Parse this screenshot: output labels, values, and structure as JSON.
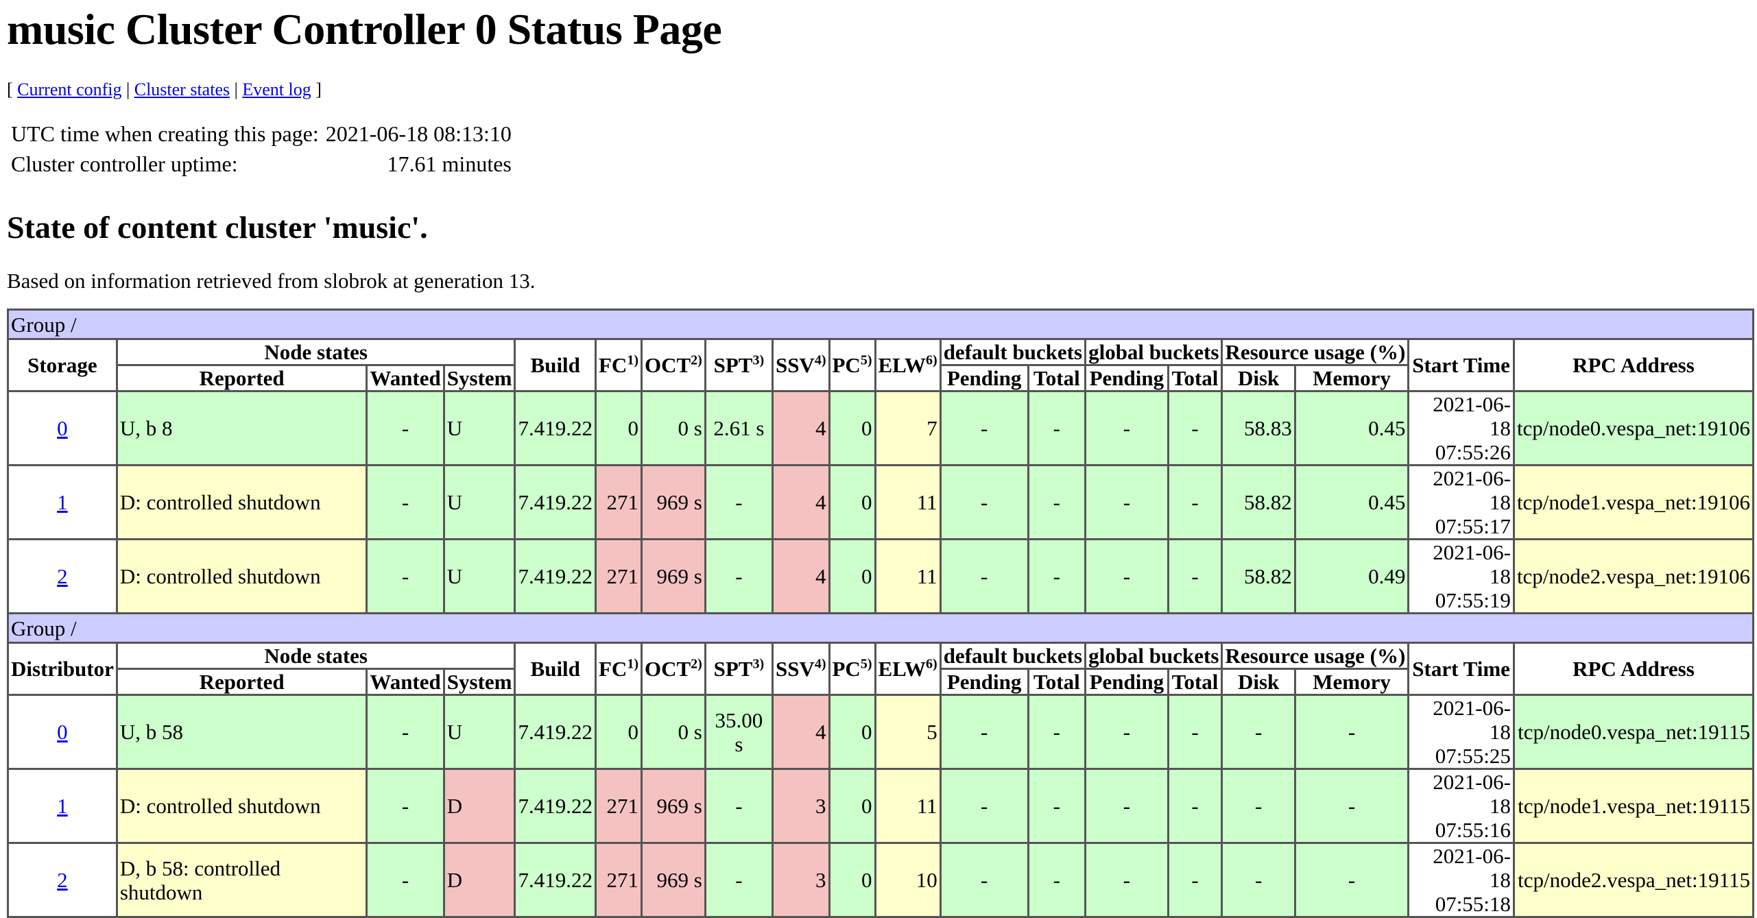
{
  "title": "music Cluster Controller 0 Status Page",
  "nav": {
    "open": "[",
    "close": "]",
    "sep": "|",
    "links": [
      "Current config",
      "Cluster states",
      "Event log"
    ]
  },
  "meta": {
    "utc_label": "UTC time when creating this page:",
    "utc_value": "2021-06-18 08:13:10",
    "uptime_label": "Cluster controller uptime:",
    "uptime_value": "17.61 minutes"
  },
  "cluster_title": "State of content cluster 'music'.",
  "based_on": "Based on information retrieved from slobrok at generation 13.",
  "headers": {
    "node_states": "Node states",
    "reported": "Reported",
    "wanted": "Wanted",
    "system": "System",
    "build": "Build",
    "fc": "FC",
    "fc_sup": "1)",
    "oct": "OCT",
    "oct_sup": "2)",
    "spt": "SPT",
    "spt_sup": "3)",
    "ssv": "SSV",
    "ssv_sup": "4)",
    "pc": "PC",
    "pc_sup": "5)",
    "elw": "ELW",
    "elw_sup": "6)",
    "default_buckets": "default buckets",
    "global_buckets": "global buckets",
    "pending": "Pending",
    "total": "Total",
    "resource_usage": "Resource usage (%)",
    "disk": "Disk",
    "memory": "Memory",
    "start_time": "Start Time",
    "rpc_address": "RPC Address"
  },
  "storage": {
    "group": "Group /",
    "type": "Storage",
    "rows": [
      {
        "idx": "0",
        "reported": "U, b 8",
        "wanted": "-",
        "system": "U",
        "build": "7.419.22",
        "fc": "0",
        "oct": "0 s",
        "spt": "2.61 s",
        "ssv": "4",
        "pc": "0",
        "elw": "7",
        "dp": "-",
        "dt": "-",
        "gp": "-",
        "gt": "-",
        "disk": "58.83",
        "mem": "0.45",
        "start1": "2021-06-18",
        "start2": "07:55:26",
        "rpc": "tcp/node0.vespa_net:19106"
      },
      {
        "idx": "1",
        "reported": "D: controlled shutdown",
        "wanted": "-",
        "system": "U",
        "build": "7.419.22",
        "fc": "271",
        "oct": "969 s",
        "spt": "-",
        "ssv": "4",
        "pc": "0",
        "elw": "11",
        "dp": "-",
        "dt": "-",
        "gp": "-",
        "gt": "-",
        "disk": "58.82",
        "mem": "0.45",
        "start1": "2021-06-18",
        "start2": "07:55:17",
        "rpc": "tcp/node1.vespa_net:19106"
      },
      {
        "idx": "2",
        "reported": "D: controlled shutdown",
        "wanted": "-",
        "system": "U",
        "build": "7.419.22",
        "fc": "271",
        "oct": "969 s",
        "spt": "-",
        "ssv": "4",
        "pc": "0",
        "elw": "11",
        "dp": "-",
        "dt": "-",
        "gp": "-",
        "gt": "-",
        "disk": "58.82",
        "mem": "0.49",
        "start1": "2021-06-18",
        "start2": "07:55:19",
        "rpc": "tcp/node2.vespa_net:19106"
      }
    ]
  },
  "distributor": {
    "group": "Group /",
    "type": "Distributor",
    "rows": [
      {
        "idx": "0",
        "reported": "U, b 58",
        "wanted": "-",
        "system": "U",
        "build": "7.419.22",
        "fc": "0",
        "oct": "0 s",
        "spt": "35.00 s",
        "ssv": "4",
        "pc": "0",
        "elw": "5",
        "dp": "-",
        "dt": "-",
        "gp": "-",
        "gt": "-",
        "disk": "-",
        "mem": "-",
        "start1": "2021-06-18",
        "start2": "07:55:25",
        "rpc": "tcp/node0.vespa_net:19115"
      },
      {
        "idx": "1",
        "reported": "D: controlled shutdown",
        "wanted": "-",
        "system": "D",
        "build": "7.419.22",
        "fc": "271",
        "oct": "969 s",
        "spt": "-",
        "ssv": "3",
        "pc": "0",
        "elw": "11",
        "dp": "-",
        "dt": "-",
        "gp": "-",
        "gt": "-",
        "disk": "-",
        "mem": "-",
        "start1": "2021-06-18",
        "start2": "07:55:16",
        "rpc": "tcp/node1.vespa_net:19115"
      },
      {
        "idx": "2",
        "reported": "D, b 58: controlled shutdown",
        "wanted": "-",
        "system": "D",
        "build": "7.419.22",
        "fc": "271",
        "oct": "969 s",
        "spt": "-",
        "ssv": "3",
        "pc": "0",
        "elw": "10",
        "dp": "-",
        "dt": "-",
        "gp": "-",
        "gt": "-",
        "disk": "-",
        "mem": "-",
        "start1": "2021-06-18",
        "start2": "07:55:18",
        "rpc": "tcp/node2.vespa_net:19115"
      }
    ]
  },
  "colors": {
    "ok": "#ccffcc",
    "warn": "#ffffcc",
    "bad": "#f5c2c2",
    "group": "#ccccff",
    "link": "#0000ee"
  }
}
